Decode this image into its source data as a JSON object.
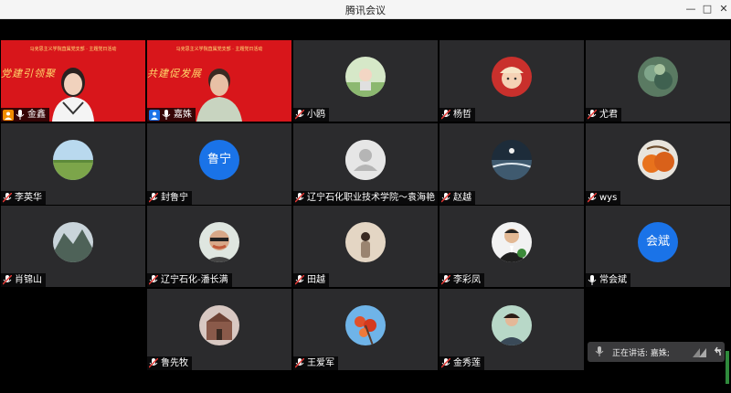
{
  "window": {
    "title": "腾讯会议"
  },
  "tiles": [
    {
      "name": "金鑫",
      "banner": "马克思主义学院直属党支部 · 主题党日活动",
      "slogan": "党建引领聚",
      "col": 0,
      "row": 0
    },
    {
      "name": "嘉姝",
      "banner": "马克思主义学院直属党支部 · 主题党日活动",
      "slogan": "共建促发展",
      "col": 1,
      "row": 0
    },
    {
      "name": "小鸥",
      "col": 2,
      "row": 0
    },
    {
      "name": "杨哲",
      "col": 3,
      "row": 0
    },
    {
      "name": "尤君",
      "col": 4,
      "row": 0
    },
    {
      "name": "李英华",
      "col": 0,
      "row": 1
    },
    {
      "name": "封鲁宁",
      "avatar_text": "鲁宁",
      "col": 1,
      "row": 1
    },
    {
      "name": "辽宁石化职业技术学院～袁海艳",
      "col": 2,
      "row": 1
    },
    {
      "name": "赵越",
      "col": 3,
      "row": 1
    },
    {
      "name": "wys",
      "col": 4,
      "row": 1
    },
    {
      "name": "肖锦山",
      "col": 0,
      "row": 2
    },
    {
      "name": "辽宁石化-潘长满",
      "col": 1,
      "row": 2
    },
    {
      "name": "田越",
      "col": 2,
      "row": 2
    },
    {
      "name": "李彩凤",
      "col": 3,
      "row": 2
    },
    {
      "name": "常会斌",
      "avatar_text": "会斌",
      "col": 4,
      "row": 2
    },
    {
      "name": "鲁先牧",
      "col": 1,
      "row": 3
    },
    {
      "name": "王爱军",
      "col": 2,
      "row": 3
    },
    {
      "name": "金秀莲",
      "col": 3,
      "row": 3
    }
  ],
  "speaking": {
    "label": "正在讲话: 嘉姝;"
  },
  "colors": {
    "accent": "#1a73e8",
    "muted_mic": "#e53935",
    "banner_red": "#d8161b"
  }
}
